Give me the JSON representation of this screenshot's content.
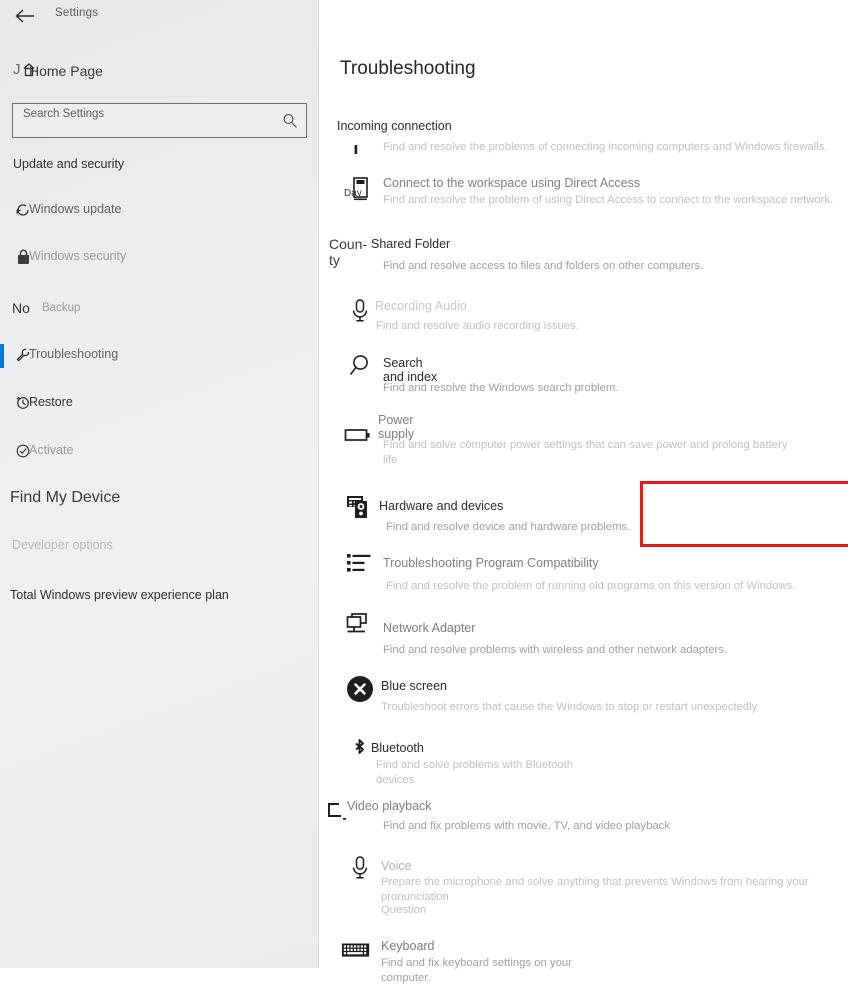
{
  "window": {
    "title": "Settings",
    "back_icon": "back-arrow-icon"
  },
  "sidebar": {
    "ghost_j": "J",
    "home_label": "Home Page",
    "search": {
      "placeholder": "Search Settings",
      "value": "",
      "icon": "search-icon"
    },
    "section_header": "Update and security",
    "ghost_no": "No",
    "items": [
      {
        "label": "Windows update",
        "icon": "refresh-icon",
        "selected": false,
        "tone": "mid"
      },
      {
        "label": "Windows security",
        "icon": "shield-icon",
        "selected": false,
        "tone": "faint"
      },
      {
        "label": "Backup",
        "icon": "upload-icon",
        "selected": false,
        "tone": "faint"
      },
      {
        "label": "Troubleshooting",
        "icon": "wrench-icon",
        "selected": true,
        "tone": "mid"
      },
      {
        "label": "Restore",
        "icon": "history-icon",
        "selected": false,
        "tone": "dark"
      },
      {
        "label": "Activate",
        "icon": "check-circle-icon",
        "selected": false,
        "tone": "faint"
      }
    ],
    "find_my_device": "Find My Device",
    "developer_options": "Developer options",
    "preview_plan": "Total Windows preview experience plan"
  },
  "main": {
    "page_title": "Troubleshooting",
    "ghost_county": "Coun-\nty",
    "items": [
      {
        "title": "Incoming connection",
        "desc": "Find and resolve the problems of connecting incoming computers and Windows firewalls.",
        "icon": "connection-icon",
        "title_tone": "dark",
        "desc_tone": "faint"
      },
      {
        "title": "Connect to the workspace using Direct Access",
        "desc": "Find and resolve the problem of using Direct Access to connect to the workspace network.",
        "icon": "monitor-icon",
        "icon_overlay": "Day",
        "title_tone": "mid",
        "desc_tone": "faint"
      },
      {
        "title": "Shared Folder",
        "desc": "Find and resolve access to files and folders on other computers.",
        "icon": "folder-share-icon",
        "title_tone": "dark",
        "desc_tone": "mid"
      },
      {
        "title": "Recording Audio",
        "desc": "Find and resolve audio recording issues.",
        "icon": "microphone-icon",
        "title_tone": "pale",
        "desc_tone": "faint"
      },
      {
        "title": "Search and index",
        "desc": "Find and resolve the Windows search problem.",
        "icon": "magnifier-icon",
        "title_tone": "dark",
        "desc_tone": "mid"
      },
      {
        "title": "Power supply",
        "desc": "Find and solve computer power settings that can save power and prolong battery life",
        "icon": "battery-icon",
        "title_tone": "mid",
        "desc_tone": "faint"
      },
      {
        "title": "Hardware and devices",
        "desc": "Find and resolve device and hardware problems.",
        "icon": "hardware-icon",
        "title_tone": "dark",
        "desc_tone": "mid",
        "highlighted": true
      },
      {
        "title": "Troubleshooting Program Compatibility",
        "desc": "Find and resolve the problem of running old programs on this version of Windows.",
        "icon": "list-icon",
        "title_tone": "mid",
        "desc_tone": "faint"
      },
      {
        "title": "Network Adapter",
        "desc": "Find and resolve problems with wireless and other network adapters.",
        "icon": "network-icon",
        "title_tone": "mid",
        "desc_tone": "mid"
      },
      {
        "title": "Blue screen",
        "desc": "Troubleshoot errors that cause the Windows to stop or restart unexpectedly",
        "icon": "error-circle-icon",
        "title_tone": "dark",
        "desc_tone": "faint"
      },
      {
        "title": "Bluetooth",
        "desc": "Find and solve problems with Bluetooth devices",
        "icon": "bluetooth-icon",
        "title_tone": "dark",
        "desc_tone": "faint"
      },
      {
        "title": "Video playback",
        "desc": "Find and fix problems with movie, TV, and video playback",
        "icon": "video-icon",
        "title_tone": "mid",
        "desc_tone": "mid"
      },
      {
        "title": "Voice",
        "desc": "Prepare the microphone and solve anything that prevents Windows from hearing your pronunciation",
        "extra": "Question",
        "icon": "microphone-icon",
        "title_tone": "faint",
        "desc_tone": "faint"
      },
      {
        "title": "Keyboard",
        "desc": "Find and fix keyboard settings on your computer.",
        "icon": "keyboard-icon",
        "title_tone": "mid",
        "desc_tone": "mid"
      }
    ]
  },
  "colors": {
    "accent": "#0078d7",
    "highlight": "#e8191a",
    "sidebar_bg": "#eceeef",
    "main_bg": "#ffffff"
  }
}
